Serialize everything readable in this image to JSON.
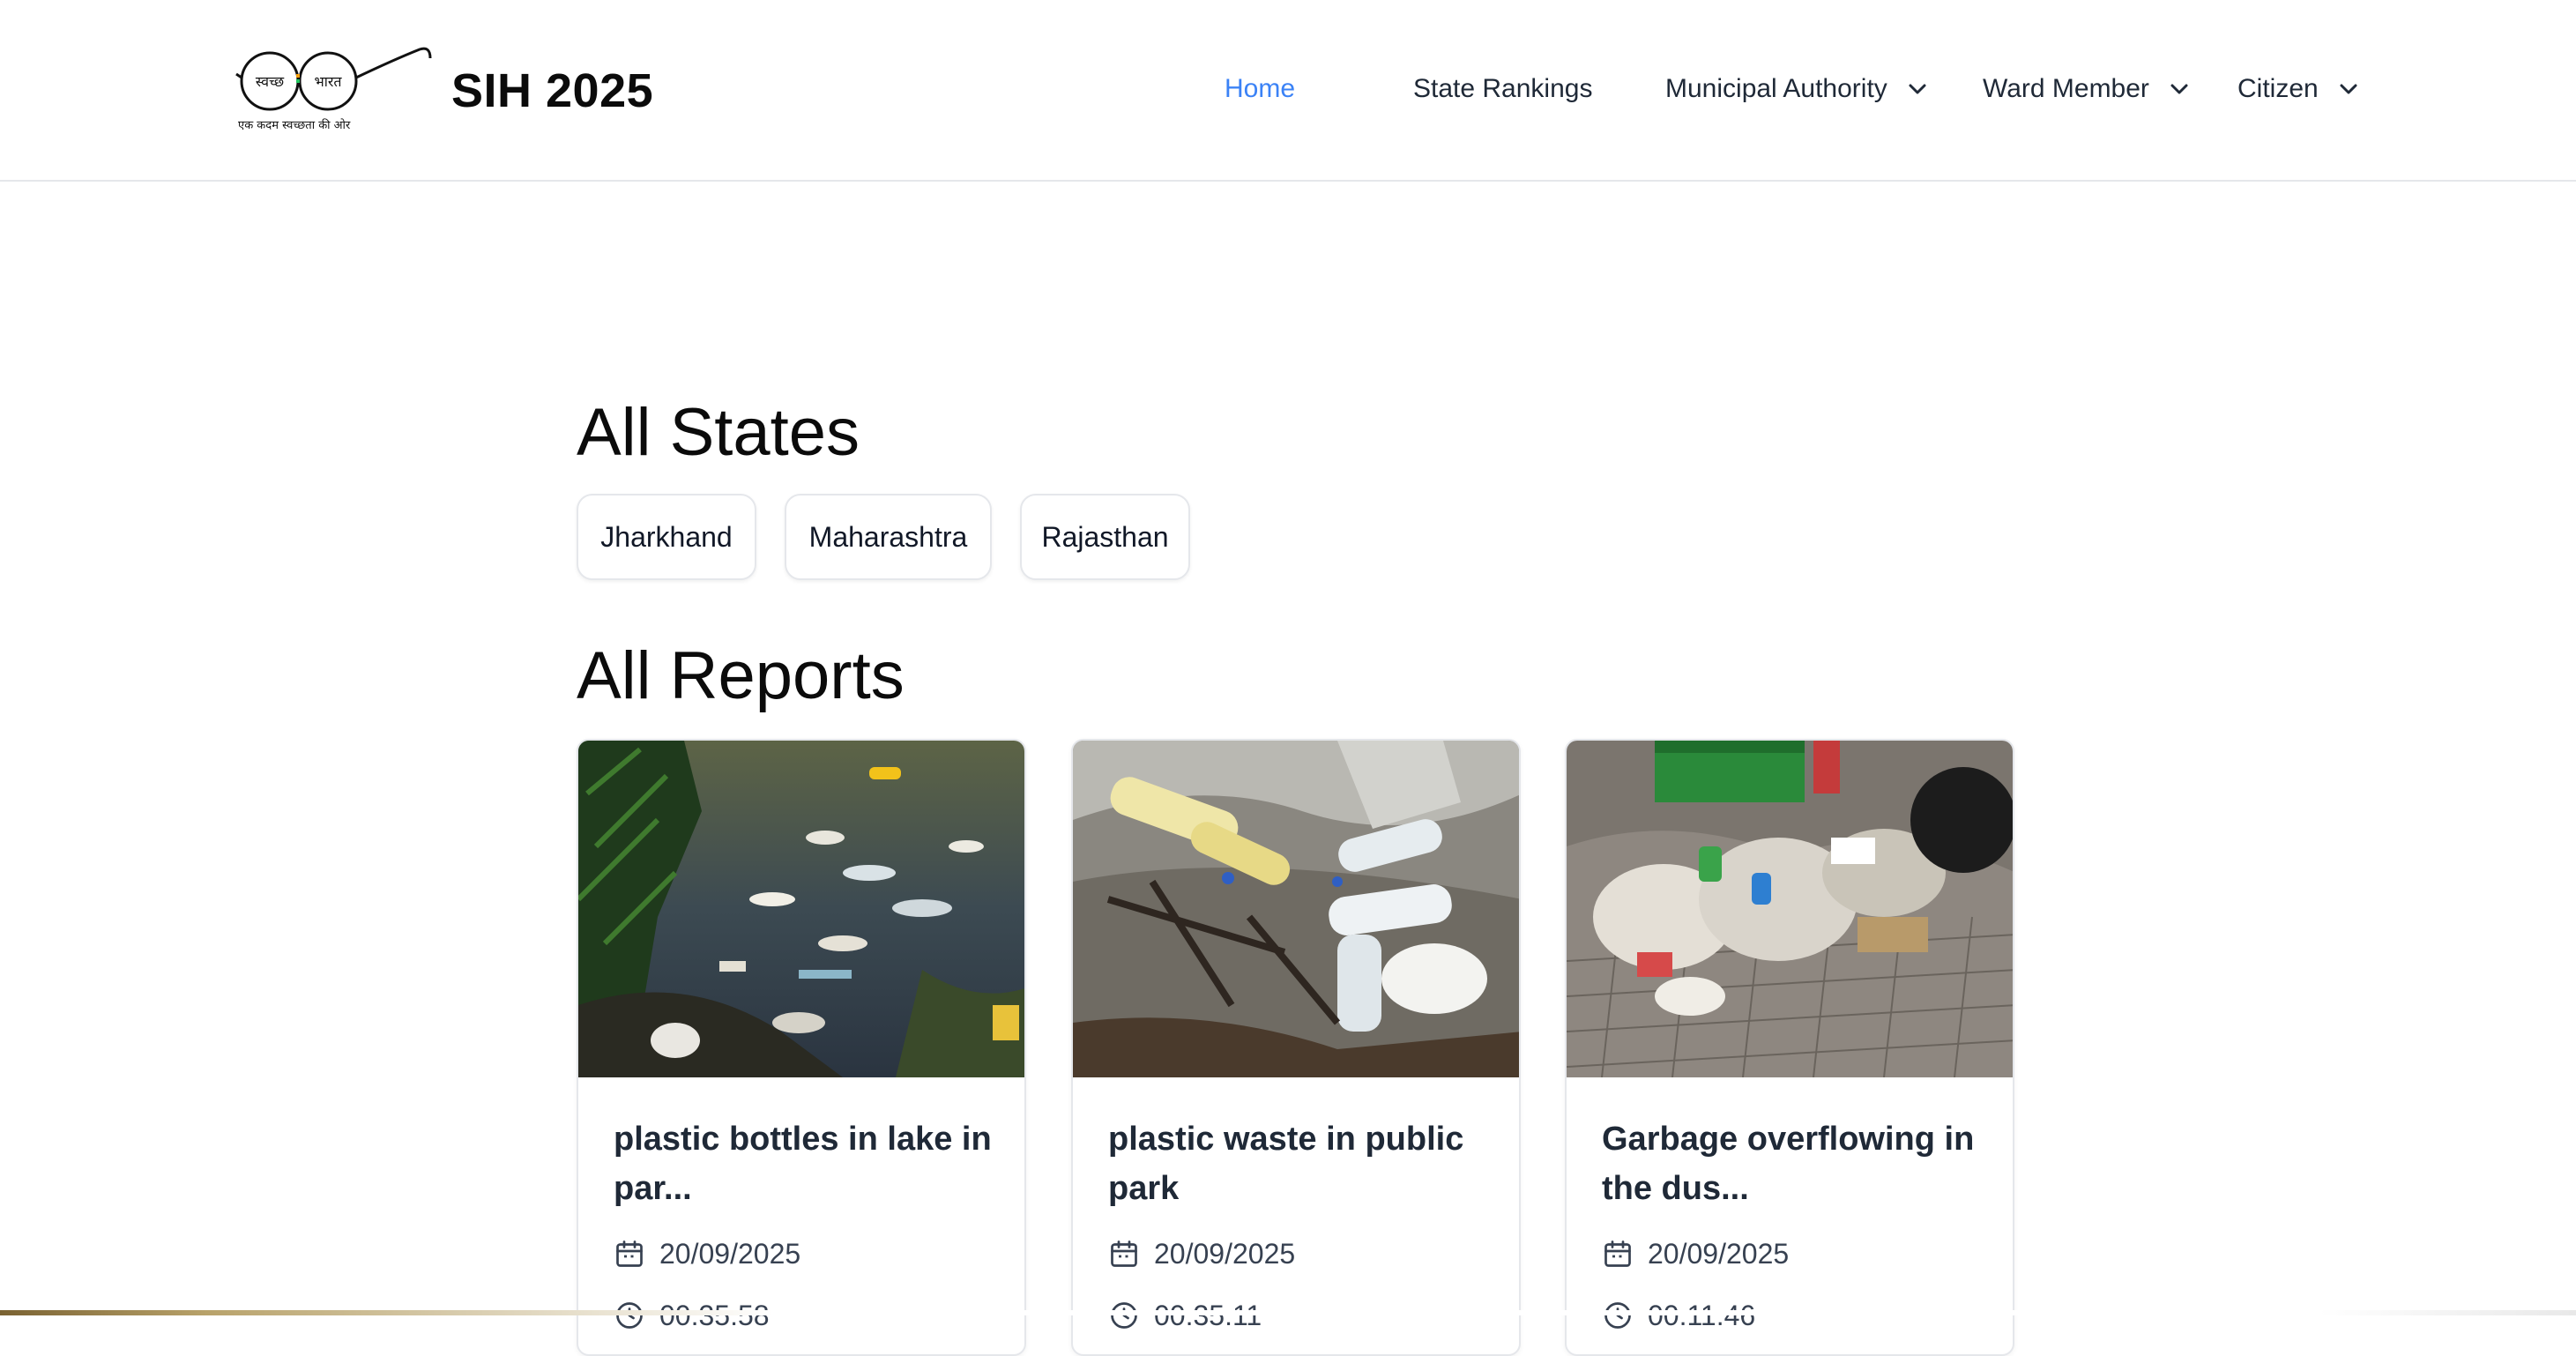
{
  "header": {
    "title": "SIH 2025",
    "logo": {
      "left_word": "स्वच्छ",
      "right_word": "भारत",
      "tagline": "एक कदम स्वच्छता की ओर"
    },
    "nav": {
      "home": "Home",
      "state_rankings": "State Rankings",
      "municipal_authority": "Municipal Authority",
      "ward_member": "Ward Member",
      "citizen": "Citizen"
    }
  },
  "states_section": {
    "title": "All States",
    "states": [
      "Jharkhand",
      "Maharashtra",
      "Rajasthan"
    ]
  },
  "reports_section": {
    "title": "All Reports",
    "reports": [
      {
        "title": "plastic bottles in lake in par...",
        "date": "20/09/2025",
        "time": "00:35:58",
        "image": "polluted-lake-photo"
      },
      {
        "title": "plastic waste in public park",
        "date": "20/09/2025",
        "time": "00:35:11",
        "image": "plastic-waste-sand-photo"
      },
      {
        "title": "Garbage overflowing in the dus...",
        "date": "20/09/2025",
        "time": "00:11:46",
        "image": "overflowing-dustbin-photo"
      }
    ]
  },
  "colors": {
    "accent": "#3b82f6",
    "text_dark": "#1f2937",
    "border": "#e5e7eb"
  }
}
